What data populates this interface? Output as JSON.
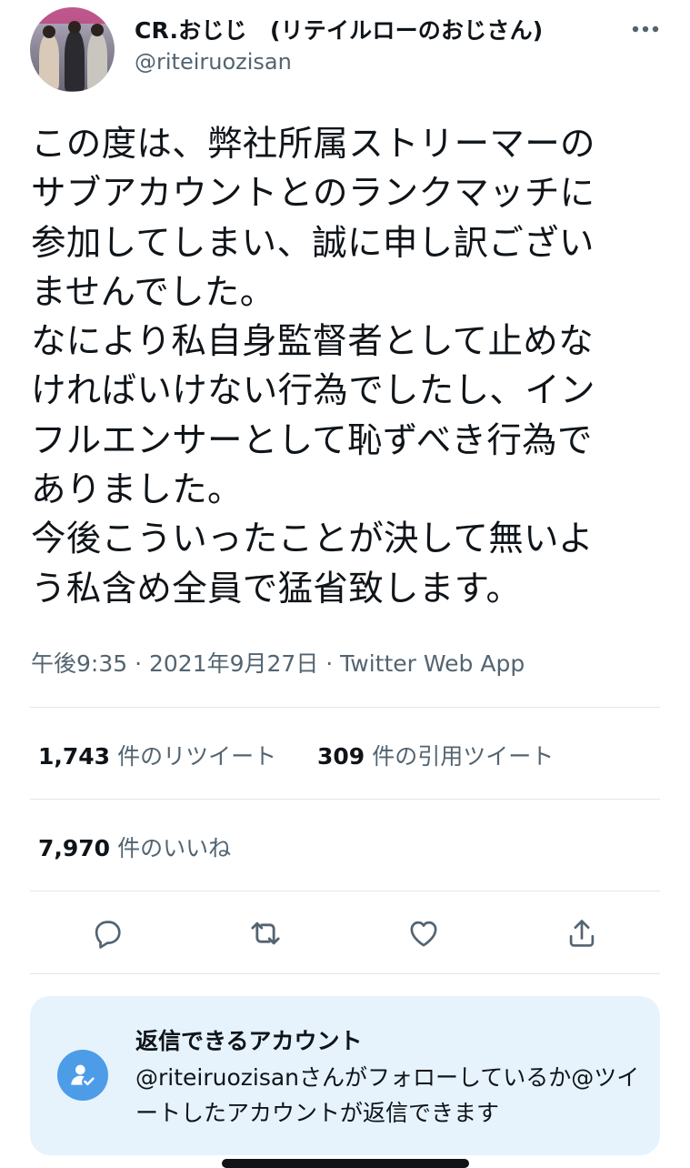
{
  "author": {
    "display_name": "CR.おじじ　(リテイルローのおじさん)",
    "handle": "@riteiruozisan"
  },
  "tweet": {
    "text": "この度は、弊社所属ストリーマーの\nサブアカウントとのランクマッチに\n参加してしまい、誠に申し訳ござい\nませんでした。\nなにより私自身監督者として止めな\nければいけない行為でしたし、イン\nフルエンサーとして恥ずべき行為で\nありました。\n今後こういったことが決して無いよ\nう私含め全員で猛省致します。",
    "meta": "午後9:35 · 2021年9月27日 · Twitter Web App"
  },
  "stats": {
    "retweets": {
      "count": "1,743",
      "label": "件のリツイート"
    },
    "quotes": {
      "count": "309",
      "label": "件の引用ツイート"
    },
    "likes": {
      "count": "7,970",
      "label": "件のいいね"
    }
  },
  "icons": {
    "more": "more-dots-icon",
    "reply": "reply-icon",
    "retweet": "retweet-icon",
    "like": "heart-icon",
    "share": "share-icon",
    "reply_permission": "user-check-icon"
  },
  "reply_settings": {
    "title": "返信できるアカウント",
    "description": "@riteiruozisanさんがフォローしているか@ツイートしたアカウントが返信できます"
  },
  "colors": {
    "text": "#0f1419",
    "secondary": "#536471",
    "accent": "#1d9bf0",
    "reply_box_bg": "#e6f3fd"
  }
}
